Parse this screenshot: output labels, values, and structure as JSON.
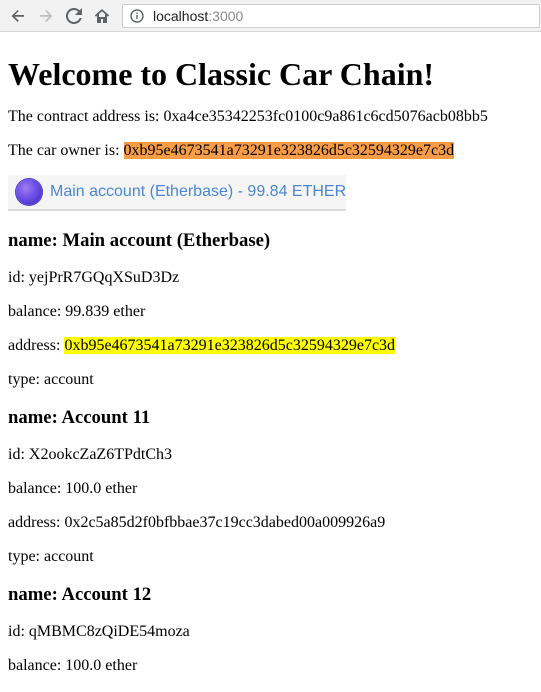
{
  "browser": {
    "url_host": "localhost",
    "url_port": ":3000"
  },
  "page": {
    "title": "Welcome to Classic Car Chain!",
    "contract_label": "The contract address is:",
    "contract_address": "0xa4ce35342253fc0100c9a861c6cd5076acb08bb5",
    "owner_label": "The car owner is:",
    "owner_address": "0xb95e4673541a73291e323826d5c32594329e7c3d"
  },
  "account_select": {
    "label": "Main account (Etherbase) - 99.84 ETHER"
  },
  "labels": {
    "name": "name:",
    "id": "id:",
    "balance": "balance:",
    "address": "address:",
    "type": "type:"
  },
  "accounts": [
    {
      "name": "Main account (Etherbase)",
      "id": "yejPrR7GQqXSuD3Dz",
      "balance": "99.839 ether",
      "address": "0xb95e4673541a73291e323826d5c32594329e7c3d",
      "type": "account"
    },
    {
      "name": "Account 11",
      "id": "X2ookcZaZ6TPdtCh3",
      "balance": "100.0 ether",
      "address": "0x2c5a85d2f0bfbbae37c19cc3dabed00a009926a9",
      "type": "account"
    },
    {
      "name": "Account 12",
      "id": "qMBMC8zQiDE54moza",
      "balance": "100.0 ether"
    }
  ],
  "colors": {
    "owner_highlight": "#f99c46",
    "address_highlight": "#ffff00",
    "select_text": "#4a86d4"
  }
}
